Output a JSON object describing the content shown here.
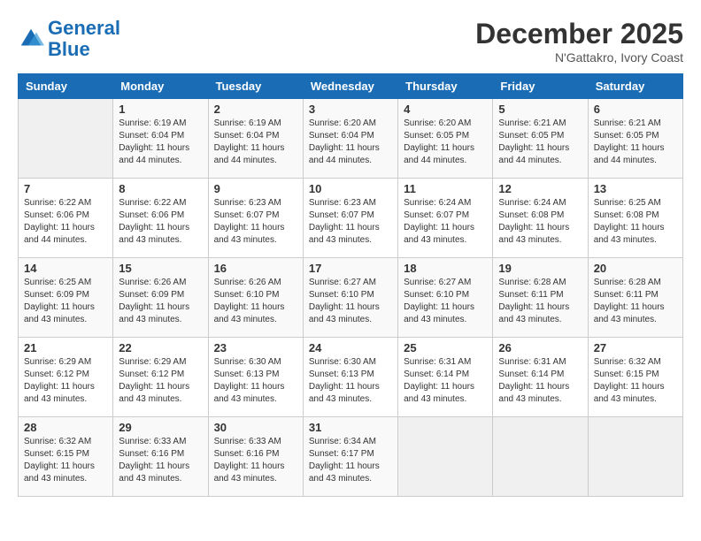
{
  "logo": {
    "line1": "General",
    "line2": "Blue"
  },
  "title": "December 2025",
  "location": "N'Gattakro, Ivory Coast",
  "days_header": [
    "Sunday",
    "Monday",
    "Tuesday",
    "Wednesday",
    "Thursday",
    "Friday",
    "Saturday"
  ],
  "weeks": [
    [
      {
        "day": "",
        "sunrise": "",
        "sunset": "",
        "daylight": ""
      },
      {
        "day": "1",
        "sunrise": "Sunrise: 6:19 AM",
        "sunset": "Sunset: 6:04 PM",
        "daylight": "Daylight: 11 hours and 44 minutes."
      },
      {
        "day": "2",
        "sunrise": "Sunrise: 6:19 AM",
        "sunset": "Sunset: 6:04 PM",
        "daylight": "Daylight: 11 hours and 44 minutes."
      },
      {
        "day": "3",
        "sunrise": "Sunrise: 6:20 AM",
        "sunset": "Sunset: 6:04 PM",
        "daylight": "Daylight: 11 hours and 44 minutes."
      },
      {
        "day": "4",
        "sunrise": "Sunrise: 6:20 AM",
        "sunset": "Sunset: 6:05 PM",
        "daylight": "Daylight: 11 hours and 44 minutes."
      },
      {
        "day": "5",
        "sunrise": "Sunrise: 6:21 AM",
        "sunset": "Sunset: 6:05 PM",
        "daylight": "Daylight: 11 hours and 44 minutes."
      },
      {
        "day": "6",
        "sunrise": "Sunrise: 6:21 AM",
        "sunset": "Sunset: 6:05 PM",
        "daylight": "Daylight: 11 hours and 44 minutes."
      }
    ],
    [
      {
        "day": "7",
        "sunrise": "Sunrise: 6:22 AM",
        "sunset": "Sunset: 6:06 PM",
        "daylight": "Daylight: 11 hours and 44 minutes."
      },
      {
        "day": "8",
        "sunrise": "Sunrise: 6:22 AM",
        "sunset": "Sunset: 6:06 PM",
        "daylight": "Daylight: 11 hours and 43 minutes."
      },
      {
        "day": "9",
        "sunrise": "Sunrise: 6:23 AM",
        "sunset": "Sunset: 6:07 PM",
        "daylight": "Daylight: 11 hours and 43 minutes."
      },
      {
        "day": "10",
        "sunrise": "Sunrise: 6:23 AM",
        "sunset": "Sunset: 6:07 PM",
        "daylight": "Daylight: 11 hours and 43 minutes."
      },
      {
        "day": "11",
        "sunrise": "Sunrise: 6:24 AM",
        "sunset": "Sunset: 6:07 PM",
        "daylight": "Daylight: 11 hours and 43 minutes."
      },
      {
        "day": "12",
        "sunrise": "Sunrise: 6:24 AM",
        "sunset": "Sunset: 6:08 PM",
        "daylight": "Daylight: 11 hours and 43 minutes."
      },
      {
        "day": "13",
        "sunrise": "Sunrise: 6:25 AM",
        "sunset": "Sunset: 6:08 PM",
        "daylight": "Daylight: 11 hours and 43 minutes."
      }
    ],
    [
      {
        "day": "14",
        "sunrise": "Sunrise: 6:25 AM",
        "sunset": "Sunset: 6:09 PM",
        "daylight": "Daylight: 11 hours and 43 minutes."
      },
      {
        "day": "15",
        "sunrise": "Sunrise: 6:26 AM",
        "sunset": "Sunset: 6:09 PM",
        "daylight": "Daylight: 11 hours and 43 minutes."
      },
      {
        "day": "16",
        "sunrise": "Sunrise: 6:26 AM",
        "sunset": "Sunset: 6:10 PM",
        "daylight": "Daylight: 11 hours and 43 minutes."
      },
      {
        "day": "17",
        "sunrise": "Sunrise: 6:27 AM",
        "sunset": "Sunset: 6:10 PM",
        "daylight": "Daylight: 11 hours and 43 minutes."
      },
      {
        "day": "18",
        "sunrise": "Sunrise: 6:27 AM",
        "sunset": "Sunset: 6:10 PM",
        "daylight": "Daylight: 11 hours and 43 minutes."
      },
      {
        "day": "19",
        "sunrise": "Sunrise: 6:28 AM",
        "sunset": "Sunset: 6:11 PM",
        "daylight": "Daylight: 11 hours and 43 minutes."
      },
      {
        "day": "20",
        "sunrise": "Sunrise: 6:28 AM",
        "sunset": "Sunset: 6:11 PM",
        "daylight": "Daylight: 11 hours and 43 minutes."
      }
    ],
    [
      {
        "day": "21",
        "sunrise": "Sunrise: 6:29 AM",
        "sunset": "Sunset: 6:12 PM",
        "daylight": "Daylight: 11 hours and 43 minutes."
      },
      {
        "day": "22",
        "sunrise": "Sunrise: 6:29 AM",
        "sunset": "Sunset: 6:12 PM",
        "daylight": "Daylight: 11 hours and 43 minutes."
      },
      {
        "day": "23",
        "sunrise": "Sunrise: 6:30 AM",
        "sunset": "Sunset: 6:13 PM",
        "daylight": "Daylight: 11 hours and 43 minutes."
      },
      {
        "day": "24",
        "sunrise": "Sunrise: 6:30 AM",
        "sunset": "Sunset: 6:13 PM",
        "daylight": "Daylight: 11 hours and 43 minutes."
      },
      {
        "day": "25",
        "sunrise": "Sunrise: 6:31 AM",
        "sunset": "Sunset: 6:14 PM",
        "daylight": "Daylight: 11 hours and 43 minutes."
      },
      {
        "day": "26",
        "sunrise": "Sunrise: 6:31 AM",
        "sunset": "Sunset: 6:14 PM",
        "daylight": "Daylight: 11 hours and 43 minutes."
      },
      {
        "day": "27",
        "sunrise": "Sunrise: 6:32 AM",
        "sunset": "Sunset: 6:15 PM",
        "daylight": "Daylight: 11 hours and 43 minutes."
      }
    ],
    [
      {
        "day": "28",
        "sunrise": "Sunrise: 6:32 AM",
        "sunset": "Sunset: 6:15 PM",
        "daylight": "Daylight: 11 hours and 43 minutes."
      },
      {
        "day": "29",
        "sunrise": "Sunrise: 6:33 AM",
        "sunset": "Sunset: 6:16 PM",
        "daylight": "Daylight: 11 hours and 43 minutes."
      },
      {
        "day": "30",
        "sunrise": "Sunrise: 6:33 AM",
        "sunset": "Sunset: 6:16 PM",
        "daylight": "Daylight: 11 hours and 43 minutes."
      },
      {
        "day": "31",
        "sunrise": "Sunrise: 6:34 AM",
        "sunset": "Sunset: 6:17 PM",
        "daylight": "Daylight: 11 hours and 43 minutes."
      },
      {
        "day": "",
        "sunrise": "",
        "sunset": "",
        "daylight": ""
      },
      {
        "day": "",
        "sunrise": "",
        "sunset": "",
        "daylight": ""
      },
      {
        "day": "",
        "sunrise": "",
        "sunset": "",
        "daylight": ""
      }
    ]
  ]
}
